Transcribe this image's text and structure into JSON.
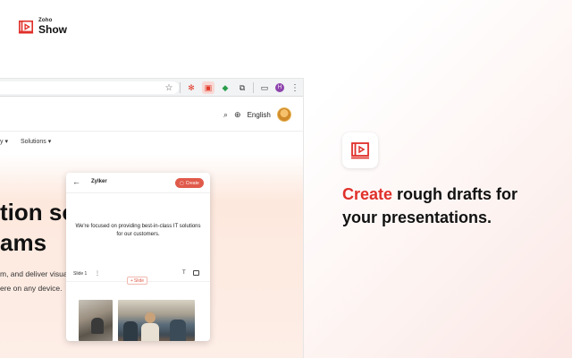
{
  "brand": {
    "small": "Zoho",
    "name": "Show",
    "icon": "zoho-show-logo-icon",
    "color": "#e0302a"
  },
  "browser": {
    "toolbar_icons": [
      "star-icon",
      "extension-icon",
      "zoho-show-extension-icon",
      "shield-extension-icon",
      "puzzle-extension-icon",
      "sidebar-icon",
      "profile-avatar",
      "menu-icon"
    ],
    "profile_initial": "H"
  },
  "site": {
    "language": "English",
    "nav": [
      "y",
      "Solutions"
    ],
    "headline": [
      "tion sof",
      "ams"
    ],
    "subtext": [
      "m, and deliver visually",
      "ere on any device."
    ]
  },
  "popup": {
    "title": "Zylker",
    "create_label": "Create",
    "slide_text": "We're focused on providing best-in-class IT solutions for our customers.",
    "slide_label": "Slide 1",
    "add_slide_label": "Slide"
  },
  "feature": {
    "accent_word": "Create",
    "rest_line1": " rough drafts for",
    "line2": "your presentations.",
    "accent_color": "#e0302a"
  }
}
